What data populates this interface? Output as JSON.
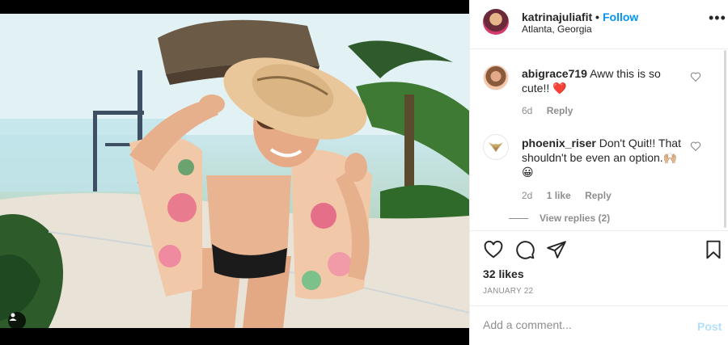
{
  "post": {
    "username": "katrinajuliafit",
    "separator": "•",
    "follow_label": "Follow",
    "location": "Atlanta, Georgia",
    "more_icon": "more-horizontal-icon",
    "more_label": "•••"
  },
  "comments": [
    {
      "username": "abigrace719",
      "text": "Aww this is so cute!! ❤️",
      "time": "6d",
      "likes": "",
      "reply_label": "Reply"
    },
    {
      "username": "phoenix_riser",
      "text": "Don't Quit!! That shouldn't be even an option.🙌🏼😀",
      "time": "2d",
      "likes": "1 like",
      "reply_label": "Reply",
      "view_replies": "View replies (2)"
    }
  ],
  "actions": {
    "like_icon": "heart-icon",
    "comment_icon": "comment-icon",
    "share_icon": "share-icon",
    "save_icon": "bookmark-icon",
    "likes": "32 likes",
    "date": "JANUARY 22"
  },
  "composer": {
    "placeholder": "Add a comment...",
    "post_label": "Post"
  },
  "colors": {
    "link_blue": "#0095f6",
    "post_disabled": "#b2dffc",
    "heart_red": "#ed4956",
    "meta_gray": "#8e8e8e"
  }
}
